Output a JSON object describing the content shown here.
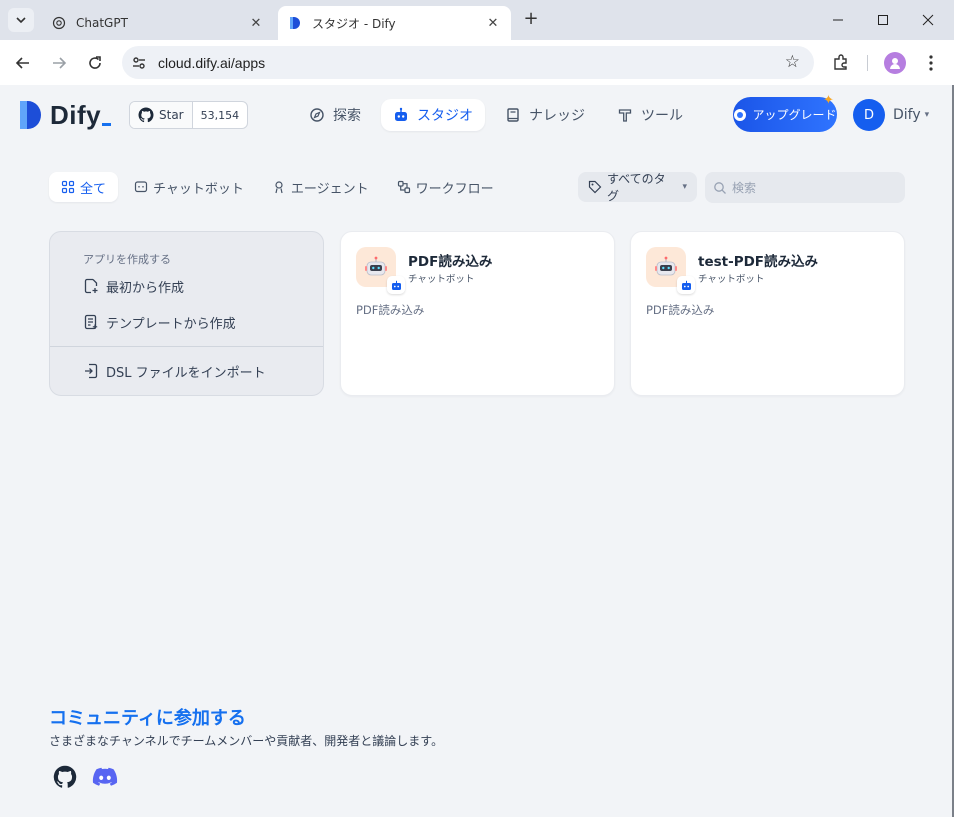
{
  "browser": {
    "tabs": [
      {
        "title": "ChatGPT",
        "favicon": "chatgpt-icon",
        "active": false
      },
      {
        "title": "スタジオ - Dify",
        "favicon": "dify-icon",
        "active": true
      }
    ],
    "new_tab": "+",
    "url": "cloud.dify.ai/apps"
  },
  "header": {
    "logo_text": "Dify",
    "github": {
      "star_label": "Star",
      "count": "53,154"
    },
    "nav": [
      {
        "label": "探索",
        "icon": "compass-icon",
        "active": false
      },
      {
        "label": "スタジオ",
        "icon": "robot-icon",
        "active": true
      },
      {
        "label": "ナレッジ",
        "icon": "book-icon",
        "active": false
      },
      {
        "label": "ツール",
        "icon": "hammer-icon",
        "active": false
      }
    ],
    "upgrade_label": "アップグレード",
    "user": {
      "initial": "D",
      "name": "Dify"
    }
  },
  "filters": {
    "tabs": [
      {
        "label": "全て",
        "icon": "grid-icon",
        "active": true
      },
      {
        "label": "チャットボット",
        "icon": "chat-bubble-icon",
        "active": false
      },
      {
        "label": "エージェント",
        "icon": "agent-icon",
        "active": false
      },
      {
        "label": "ワークフロー",
        "icon": "workflow-icon",
        "active": false
      }
    ],
    "tag_filter_label": "すべてのタグ",
    "search_placeholder": "検索"
  },
  "create": {
    "title": "アプリを作成する",
    "blank": "最初から作成",
    "template": "テンプレートから作成",
    "import": "DSL ファイルをインポート"
  },
  "apps": [
    {
      "name": "PDF読み込み",
      "type": "チャットボット",
      "description": "PDF読み込み"
    },
    {
      "name": "test-PDF読み込み",
      "type": "チャットボット",
      "description": "PDF読み込み"
    }
  ],
  "community": {
    "title": "コミュニティに参加する",
    "description": "さまざまなチャンネルでチームメンバーや貢献者、開発者と議論します。"
  },
  "colors": {
    "accent": "#155eef",
    "background": "#f2f4f7",
    "community_title": "#1570ef"
  }
}
